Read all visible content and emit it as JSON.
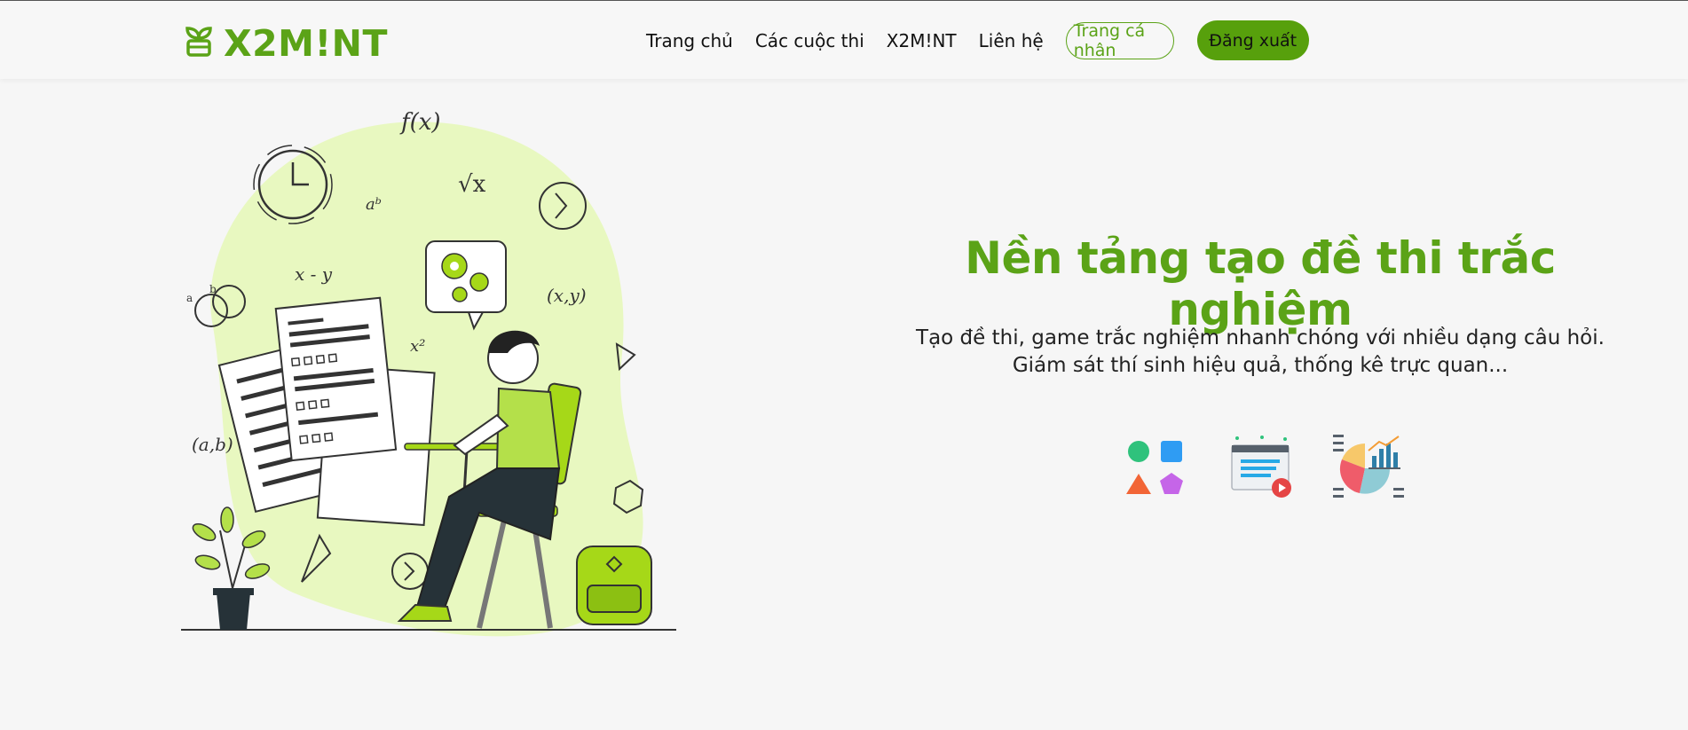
{
  "brand": {
    "name": "X2M!NT",
    "logo_icon": "sprout-icon",
    "color": "#5ba317"
  },
  "nav": {
    "links": [
      "Trang chủ",
      "Các cuộc thi",
      "X2M!NT",
      "Liên hệ"
    ],
    "profile_button": "Trang cá nhân",
    "logout_button": "Đăng xuất"
  },
  "hero": {
    "title": "Nền tảng tạo đề thi trắc nghiệm",
    "subtitle_line1": "Tạo đề thi, game trắc nghiệm nhanh chóng với nhiều dạng câu hỏi.",
    "subtitle_line2": "Giám sát thí sinh hiệu quả, thống kê trực quan...",
    "illustration": "student-taking-exam-illustration",
    "illustration_texts": [
      "f(x)",
      "aᵇ",
      "√x",
      "x - y",
      "x²",
      "(x,y)",
      "(a,b)",
      "a",
      "b"
    ],
    "features": [
      {
        "icon": "shapes-icon"
      },
      {
        "icon": "video-lesson-icon"
      },
      {
        "icon": "statistics-chart-icon"
      }
    ]
  },
  "colors": {
    "accent": "#5ba317",
    "button": "#57a00c",
    "blob": "#e8f8c0",
    "background": "#f6f6f6"
  }
}
